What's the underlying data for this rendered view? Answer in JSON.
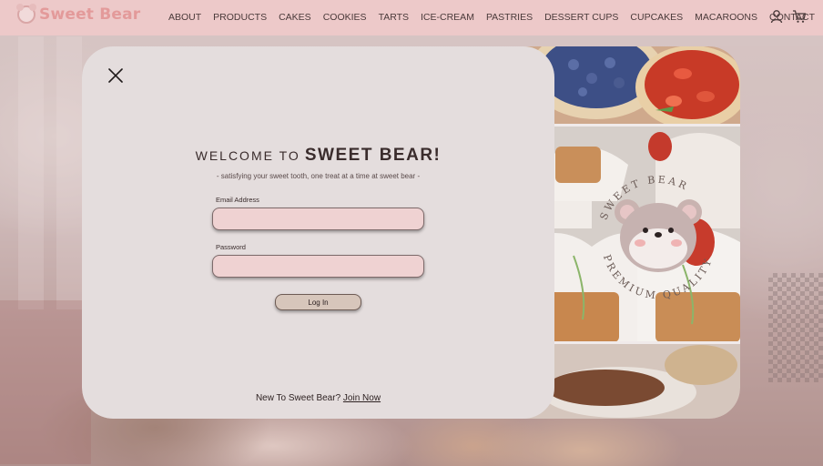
{
  "brand": {
    "name": "Sweet Bear",
    "icon": "bear-logo-icon"
  },
  "nav": {
    "items": [
      "ABOUT",
      "PRODUCTS",
      "CAKES",
      "COOKIES",
      "TARTS",
      "ICE-CREAM",
      "PASTRIES",
      "DESSERT CUPS",
      "CUPCAKES",
      "MACAROONS",
      "CONTACT"
    ],
    "icons": {
      "account": "user-icon",
      "cart": "cart-icon"
    }
  },
  "modal": {
    "close_icon": "close-icon",
    "welcome_prefix": "WELCOME TO",
    "welcome_brand": "SWEET BEAR!",
    "tagline": "- satisfying your sweet tooth, one treat at a time at sweet bear -",
    "email_label": "Email Address",
    "email_value": "",
    "password_label": "Password",
    "password_value": "",
    "login_label": "Log In",
    "signup_prompt": "New To Sweet Bear?",
    "signup_link": "Join Now"
  },
  "seal": {
    "top_text": "SWEET BEAR",
    "bottom_text": "PREMIUM QUALITY"
  },
  "colors": {
    "navbar": "#edc9c9",
    "brand": "#e39a9a",
    "panel": "#e4dddd",
    "input": "#efd2d2",
    "button": "#d7c6bb"
  }
}
